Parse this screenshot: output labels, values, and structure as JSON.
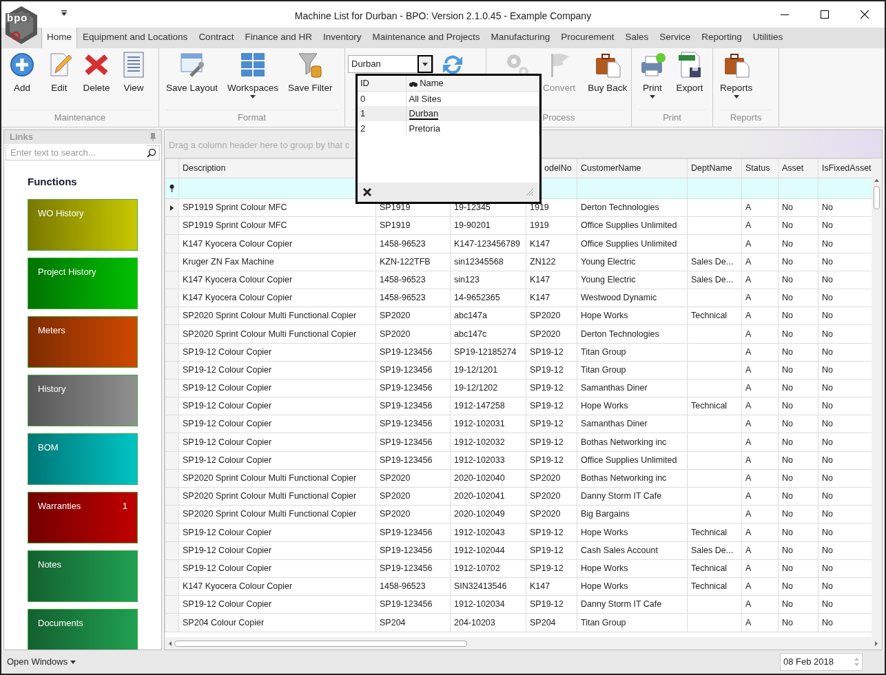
{
  "window": {
    "logo_text": "bpo",
    "title": "Machine List for Durban - BPO: Version 2.1.0.45 - Example Company"
  },
  "tabs": [
    {
      "label": "Home",
      "selected": true
    },
    {
      "label": "Equipment and Locations",
      "selected": false
    },
    {
      "label": "Contract",
      "selected": false
    },
    {
      "label": "Finance and HR",
      "selected": false
    },
    {
      "label": "Inventory",
      "selected": false
    },
    {
      "label": "Maintenance and Projects",
      "selected": false
    },
    {
      "label": "Manufacturing",
      "selected": false
    },
    {
      "label": "Procurement",
      "selected": false
    },
    {
      "label": "Sales",
      "selected": false
    },
    {
      "label": "Service",
      "selected": false
    },
    {
      "label": "Reporting",
      "selected": false
    },
    {
      "label": "Utilities",
      "selected": false
    }
  ],
  "ribbon": [
    {
      "label": "Maintenance",
      "buttons": [
        {
          "label": "Add",
          "disabled": false
        },
        {
          "label": "Edit",
          "disabled": false
        },
        {
          "label": "Delete",
          "disabled": false
        },
        {
          "label": "View",
          "disabled": false
        }
      ]
    },
    {
      "label": "Format",
      "buttons": [
        {
          "label": "Save Layout",
          "disabled": false
        },
        {
          "label": "Workspaces",
          "disabled": false,
          "dropdown": true
        },
        {
          "label": "Save Filter",
          "disabled": false
        }
      ]
    },
    {
      "kind": "site",
      "site": {
        "value": "Durban"
      },
      "buttons": [
        {
          "disabled": false
        }
      ]
    },
    {
      "label": "Process",
      "buttons": [
        {
          "disabled": true
        },
        {
          "label": "Convert",
          "disabled": true
        },
        {
          "label": "Buy Back",
          "disabled": false
        }
      ]
    },
    {
      "label": "Print",
      "buttons": [
        {
          "label": "Print",
          "disabled": false,
          "dropdown": true
        },
        {
          "label": "Export",
          "disabled": false
        }
      ]
    },
    {
      "label": "Reports",
      "buttons": [
        {
          "label": "Reports",
          "disabled": false,
          "dropdown": true
        }
      ]
    }
  ],
  "site_dropdown": {
    "columns": [
      "ID",
      "Name"
    ],
    "rows": [
      {
        "id": "0",
        "name": "All Sites",
        "selected": false
      },
      {
        "id": "1",
        "name": "Durban",
        "selected": true
      },
      {
        "id": "2",
        "name": "Pretoria",
        "selected": false
      }
    ]
  },
  "links": {
    "title": "Links",
    "search": {
      "placeholder": "Enter text to search..."
    },
    "heading": "Functions",
    "tiles": [
      {
        "label": "WO History",
        "color": "#c8c800"
      },
      {
        "label": "Project History",
        "color": "#00c000"
      },
      {
        "label": "Meters",
        "color": "#d04800"
      },
      {
        "label": "History",
        "color": "#909090"
      },
      {
        "label": "BOM",
        "color": "#00c4c4"
      },
      {
        "label": "Warranties",
        "color": "#c00000",
        "count": "1"
      },
      {
        "label": "Notes",
        "color": "#20a050"
      },
      {
        "label": "Documents",
        "color": "#20a050"
      }
    ]
  },
  "grid": {
    "group_panel": "Drag a column header here to group by that c",
    "columns": [
      {
        "kind": "labeled",
        "label": "Description"
      },
      {
        "kind": "covered"
      },
      {
        "kind": "covered"
      },
      {
        "kind": "labeled",
        "label": "odelNo"
      },
      {
        "kind": "labeled",
        "label": "CustomerName"
      },
      {
        "kind": "labeled",
        "label": "DeptName"
      },
      {
        "kind": "labeled",
        "label": "Status"
      },
      {
        "kind": "labeled",
        "label": "Asset"
      },
      {
        "kind": "labeled",
        "label": "IsFixedAsset"
      }
    ],
    "rows": [
      {
        "selected": true,
        "cells": [
          "SP1919 Sprint Colour MFC",
          "SP1919",
          "19-12345",
          "1919",
          "Derton Technologies",
          "",
          "A",
          "No",
          "No"
        ]
      },
      {
        "selected": false,
        "cells": [
          "SP1919 Sprint Colour MFC",
          "SP1919",
          "19-90201",
          "1919",
          "Office Supplies Unlimited",
          "",
          "A",
          "No",
          "No"
        ]
      },
      {
        "selected": false,
        "cells": [
          "K147 Kyocera Colour Copier",
          "1458-96523",
          "K147-123456789",
          "K147",
          "Office Supplies Unlimited",
          "",
          "A",
          "No",
          "No"
        ]
      },
      {
        "selected": false,
        "cells": [
          "Kruger ZN Fax Machine",
          "KZN-122TFB",
          "sin12345568",
          "ZN122",
          "Young Electric",
          "Sales De...",
          "A",
          "No",
          "No"
        ]
      },
      {
        "selected": false,
        "cells": [
          "K147 Kyocera Colour Copier",
          "1458-96523",
          "sin123",
          "K147",
          "Young Electric",
          "Sales De...",
          "A",
          "No",
          "No"
        ]
      },
      {
        "selected": false,
        "cells": [
          "K147 Kyocera Colour Copier",
          "1458-96523",
          "14-9652365",
          "K147",
          "Westwood Dynamic",
          "",
          "A",
          "No",
          "No"
        ]
      },
      {
        "selected": false,
        "cells": [
          "SP2020 Sprint Colour Multi Functional Copier",
          "SP2020",
          "abc147a",
          "SP2020",
          "Hope Works",
          "Technical",
          "A",
          "No",
          "No"
        ]
      },
      {
        "selected": false,
        "cells": [
          "SP2020 Sprint Colour Multi Functional Copier",
          "SP2020",
          "abc147c",
          "SP2020",
          "Derton Technologies",
          "",
          "A",
          "No",
          "No"
        ]
      },
      {
        "selected": false,
        "cells": [
          "SP19-12 Colour Copier",
          "SP19-123456",
          "SP19-12185274",
          "SP19-12",
          "Titan Group",
          "",
          "A",
          "No",
          "No"
        ]
      },
      {
        "selected": false,
        "cells": [
          "SP19-12 Colour Copier",
          "SP19-123456",
          "19-12/1201",
          "SP19-12",
          "Titan Group",
          "",
          "A",
          "No",
          "No"
        ]
      },
      {
        "selected": false,
        "cells": [
          "SP19-12 Colour Copier",
          "SP19-123456",
          "19-12/1202",
          "SP19-12",
          "Samanthas Diner",
          "",
          "A",
          "No",
          "No"
        ]
      },
      {
        "selected": false,
        "cells": [
          "SP19-12 Colour Copier",
          "SP19-123456",
          "1912-147258",
          "SP19-12",
          "Hope Works",
          "Technical",
          "A",
          "No",
          "No"
        ]
      },
      {
        "selected": false,
        "cells": [
          "SP19-12 Colour Copier",
          "SP19-123456",
          "1912-102031",
          "SP19-12",
          "Samanthas Diner",
          "",
          "A",
          "No",
          "No"
        ]
      },
      {
        "selected": false,
        "cells": [
          "SP19-12 Colour Copier",
          "SP19-123456",
          "1912-102032",
          "SP19-12",
          "Bothas Networking inc",
          "",
          "A",
          "No",
          "No"
        ]
      },
      {
        "selected": false,
        "cells": [
          "SP19-12 Colour Copier",
          "SP19-123456",
          "1912-102033",
          "SP19-12",
          "Office Supplies Unlimited",
          "",
          "A",
          "No",
          "No"
        ]
      },
      {
        "selected": false,
        "cells": [
          "SP2020 Sprint Colour Multi Functional Copier",
          "SP2020",
          "2020-102040",
          "SP2020",
          "Bothas Networking inc",
          "",
          "A",
          "No",
          "No"
        ]
      },
      {
        "selected": false,
        "cells": [
          "SP2020 Sprint Colour Multi Functional Copier",
          "SP2020",
          "2020-102041",
          "SP2020",
          "Danny Storm IT Cafe",
          "",
          "A",
          "No",
          "No"
        ]
      },
      {
        "selected": false,
        "cells": [
          "SP2020 Sprint Colour Multi Functional Copier",
          "SP2020",
          "2020-102049",
          "SP2020",
          "Big Bargains",
          "",
          "A",
          "No",
          "No"
        ]
      },
      {
        "selected": false,
        "cells": [
          "SP19-12 Colour Copier",
          "SP19-123456",
          "1912-102043",
          "SP19-12",
          "Hope Works",
          "Technical",
          "A",
          "No",
          "No"
        ]
      },
      {
        "selected": false,
        "cells": [
          "SP19-12 Colour Copier",
          "SP19-123456",
          "1912-102044",
          "SP19-12",
          "Cash Sales Account",
          "Sales De...",
          "A",
          "No",
          "No"
        ]
      },
      {
        "selected": false,
        "cells": [
          "SP19-12 Colour Copier",
          "SP19-123456",
          "1912-10702",
          "SP19-12",
          "Hope Works",
          "Technical",
          "A",
          "No",
          "No"
        ]
      },
      {
        "selected": false,
        "cells": [
          "K147 Kyocera Colour Copier",
          "1458-96523",
          "SIN32413546",
          "K147",
          "Hope Works",
          "Technical",
          "A",
          "No",
          "No"
        ]
      },
      {
        "selected": false,
        "cells": [
          "SP19-12 Colour Copier",
          "SP19-123456",
          "1912-102034",
          "SP19-12",
          "Danny Storm IT Cafe",
          "",
          "A",
          "No",
          "No"
        ]
      },
      {
        "selected": false,
        "cells": [
          "SP204 Colour Copier",
          "SP204",
          "204-10203",
          "SP204",
          "Titan Group",
          "",
          "A",
          "No",
          "No"
        ]
      }
    ]
  },
  "status_bar": {
    "menu": "Open Windows",
    "date": "08 Feb 2018"
  }
}
